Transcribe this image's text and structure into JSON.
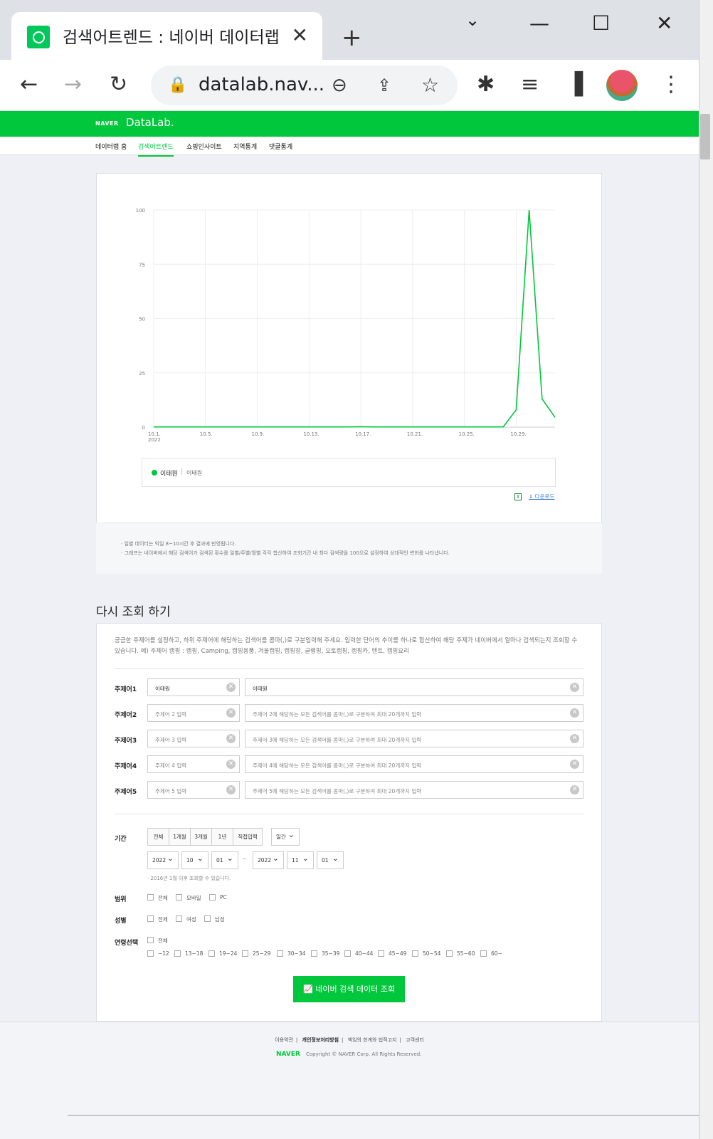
{
  "browser": {
    "tab_title": "검색어트렌드 : 네이버 데이터랩",
    "tab_close": "✕",
    "new_tab": "+",
    "url": "datalab.nav...",
    "win_min": "—",
    "win_max": "☐",
    "win_close": "✕"
  },
  "site": {
    "logo": "NAVER",
    "product": "DataLab.",
    "nav": [
      "데이터랩 홈",
      "검색어트렌드",
      "쇼핑인사이트",
      "지역통계",
      "댓글통계"
    ],
    "active_nav": "검색어트렌드"
  },
  "chart_data": {
    "type": "line",
    "x": [
      "2022-10-01",
      "2022-10-02",
      "2022-10-03",
      "2022-10-04",
      "2022-10-05",
      "2022-10-06",
      "2022-10-07",
      "2022-10-08",
      "2022-10-09",
      "2022-10-10",
      "2022-10-11",
      "2022-10-12",
      "2022-10-13",
      "2022-10-14",
      "2022-10-15",
      "2022-10-16",
      "2022-10-17",
      "2022-10-18",
      "2022-10-19",
      "2022-10-20",
      "2022-10-21",
      "2022-10-22",
      "2022-10-23",
      "2022-10-24",
      "2022-10-25",
      "2022-10-26",
      "2022-10-27",
      "2022-10-28",
      "2022-10-29",
      "2022-10-30",
      "2022-10-31",
      "2022-11-01"
    ],
    "series": [
      {
        "name": "이태원",
        "color": "#00c73c",
        "values": [
          0.1,
          0.1,
          0.1,
          0.1,
          0.1,
          0.1,
          0.1,
          0.1,
          0.1,
          0.1,
          0.1,
          0.1,
          0.1,
          0.1,
          0.1,
          0.1,
          0.2,
          0.1,
          0.1,
          0.1,
          0.1,
          0.1,
          0.1,
          0.1,
          0.1,
          0.1,
          0.1,
          0.1,
          8,
          100,
          13,
          4.5
        ]
      }
    ],
    "yticks": [
      "0",
      "25",
      "50",
      "75",
      "100"
    ],
    "xtick_labels": [
      "10.1.\n2022",
      "10.5.",
      "10.9.",
      "10.13.",
      "10.17.",
      "10.21.",
      "10.25.",
      "10.29."
    ],
    "ylim": [
      0,
      100
    ],
    "grid": true
  },
  "legend": {
    "name": "이태원",
    "sep": "|",
    "keywords": "이태원"
  },
  "download": {
    "excel_icon": "X",
    "label": "다운로드"
  },
  "notes": [
    "· 일별 데이터는 익일 8~10시간 후 결과에 반영됩니다.",
    "· 그래프는 네이버에서 해당 검색어가 검색된 횟수를 일별/주별/월별 각각 합산하여 조회기간 내 최다 검색량을 100으로 설정하여 상대적인 변화를 나타냅니다."
  ],
  "form": {
    "title": "다시 조회 하기",
    "intro": "궁금한 주제어를 설정하고, 하위 주제어에 해당하는 검색어를 콤마(,)로 구분입력해 주세요. 입력한 단어의 추이를 하나로 합산하여 해당 주제가 네이버에서 얼마나 검색되는지 조회할 수 있습니다. 예) 주제어 캠핑 : 캠핑, Camping, 캠핑용품, 겨울캠핑, 캠핑장, 글램핑, 오토캠핑, 캠핑카, 텐트, 캠핑요리",
    "rows": [
      {
        "label": "주제어1",
        "topic": "이태원",
        "topic_filled": true,
        "keywords": "이태원",
        "kw_filled": true
      },
      {
        "label": "주제어2",
        "topic": "주제어 2 입력",
        "topic_filled": false,
        "keywords": "주제어 2에 해당하는 모든 검색어를 콤마(,)로 구분하여 최대 20개까지 입력",
        "kw_filled": false
      },
      {
        "label": "주제어3",
        "topic": "주제어 3 입력",
        "topic_filled": false,
        "keywords": "주제어 3에 해당하는 모든 검색어를 콤마(,)로 구분하여 최대 20개까지 입력",
        "kw_filled": false
      },
      {
        "label": "주제어4",
        "topic": "주제어 4 입력",
        "topic_filled": false,
        "keywords": "주제어 4에 해당하는 모든 검색어를 콤마(,)로 구분하여 최대 20개까지 입력",
        "kw_filled": false
      },
      {
        "label": "주제어5",
        "topic": "주제어 5 입력",
        "topic_filled": false,
        "keywords": "주제어 5에 해당하는 모든 검색어를 콤마(,)로 구분하여 최대 20개까지 입력",
        "kw_filled": false
      }
    ],
    "period_label": "기간",
    "period_buttons": [
      "전체",
      "1개월",
      "3개월",
      "1년",
      "직접입력"
    ],
    "interval": "일간",
    "start": {
      "year": "2022",
      "month": "10",
      "day": "01"
    },
    "end": {
      "year": "2022",
      "month": "11",
      "day": "01"
    },
    "range_sep": "~",
    "period_note": "· 2016년 1월 이후 조회할 수 있습니다.",
    "scope_label": "범위",
    "scope_options": [
      "전체",
      "모바일",
      "PC"
    ],
    "gender_label": "성별",
    "gender_options": [
      "전체",
      "여성",
      "남성"
    ],
    "age_label": "연령선택",
    "age_all": "전체",
    "age_options": [
      "~12",
      "13~18",
      "19~24",
      "25~29",
      "30~34",
      "35~39",
      "40~44",
      "45~49",
      "50~54",
      "55~60",
      "60~"
    ],
    "submit": "네이버 검색 데이터 조회"
  },
  "footer": {
    "links": [
      "이용약관",
      "개인정보처리방침",
      "책임의 한계와 법적고지",
      "고객센터"
    ],
    "logo": "NAVER",
    "copyright": "Copyright © NAVER Corp. All Rights Reserved."
  }
}
